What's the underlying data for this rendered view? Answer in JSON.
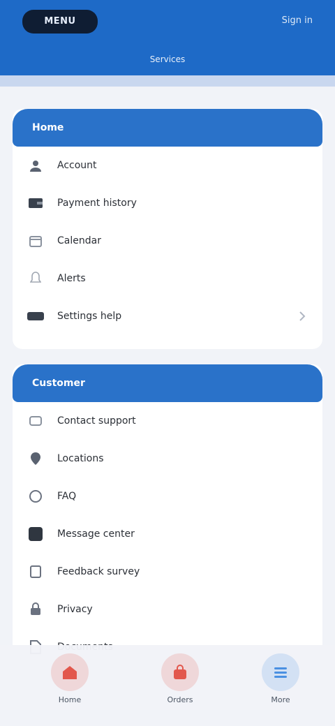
{
  "appbar": {
    "brand": "MENU",
    "right_action": "Sign in",
    "tab": "Services",
    "bg": "#1e6ac7"
  },
  "sections": [
    {
      "title": "Home",
      "items": [
        {
          "label": "Account",
          "icon": "user-icon"
        },
        {
          "label": "Payment history",
          "icon": "wallet-icon"
        },
        {
          "label": "Calendar",
          "icon": "calendar-icon"
        },
        {
          "label": "Alerts",
          "icon": "bell-icon"
        },
        {
          "label": "Settings help",
          "icon": "help-icon",
          "chevron": true
        }
      ]
    },
    {
      "title": "Customer",
      "items": [
        {
          "label": "Contact support",
          "icon": "headset-icon"
        },
        {
          "label": "Locations",
          "icon": "pin-icon"
        },
        {
          "label": "FAQ",
          "icon": "faq-icon"
        },
        {
          "label": "Message center",
          "icon": "chat-icon"
        },
        {
          "label": "Feedback survey",
          "icon": "clipboard-icon"
        },
        {
          "label": "Privacy",
          "icon": "lock-icon"
        },
        {
          "label": "Documents",
          "icon": "document-icon"
        }
      ]
    }
  ],
  "bottom_nav": [
    {
      "label": "Home",
      "icon": "home-icon",
      "color": "#e2574c"
    },
    {
      "label": "Orders",
      "icon": "bag-icon",
      "color": "#e2574c"
    },
    {
      "label": "More",
      "icon": "menu-icon",
      "color": "#4a90e2"
    }
  ]
}
